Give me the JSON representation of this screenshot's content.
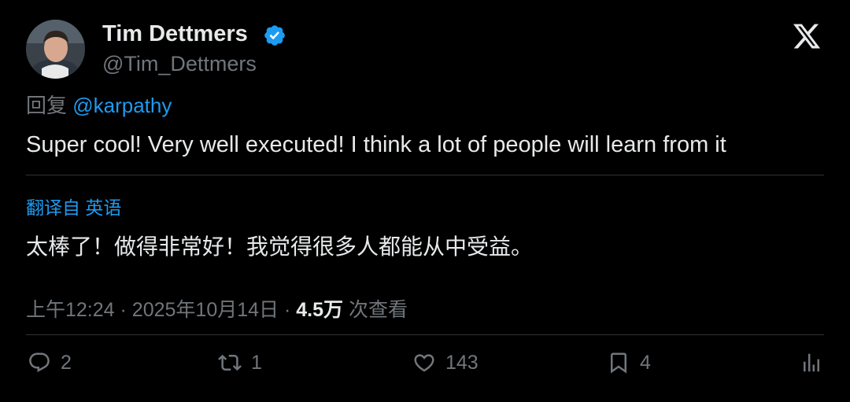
{
  "author": {
    "name": "Tim Dettmers",
    "handle": "@Tim_Dettmers"
  },
  "icons": {
    "verified": "verified-badge-icon",
    "close": "x-logo-icon"
  },
  "colors": {
    "accent": "#1d9bf0",
    "muted": "#71767b",
    "text": "#e7e9ea",
    "background": "#000000"
  },
  "reply": {
    "prefix": "回复",
    "mention": "@karpathy"
  },
  "tweet": {
    "text": "Super cool! Very well executed! I think a lot of people will learn from it"
  },
  "translation": {
    "label": "翻译自 英语",
    "text": "太棒了！做得非常好！我觉得很多人都能从中受益。"
  },
  "meta": {
    "time": "上午12:24",
    "sep1": "·",
    "date": "2025年10月14日",
    "sep2": "·",
    "views_count": "4.5万",
    "views_label": "次查看"
  },
  "actions": {
    "replies": "2",
    "reposts": "1",
    "likes": "143",
    "bookmarks": "4"
  }
}
